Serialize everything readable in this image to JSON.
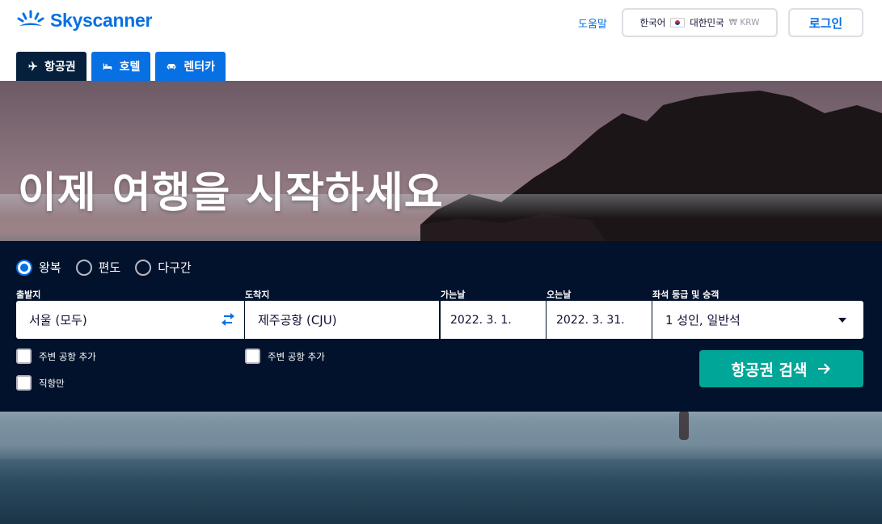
{
  "header": {
    "brand": "Skyscanner",
    "help_label": "도움말",
    "locale": {
      "language": "한국어",
      "country": "대한민국",
      "currency": "₩ KRW"
    },
    "login_label": "로그인"
  },
  "tabs": [
    {
      "label": "항공권",
      "icon": "airplane-icon",
      "active": true
    },
    {
      "label": "호텔",
      "icon": "bed-icon",
      "active": false
    },
    {
      "label": "렌터카",
      "icon": "car-icon",
      "active": false
    }
  ],
  "hero": {
    "title": "이제 여행을 시작하세요"
  },
  "search": {
    "trip_types": [
      {
        "label": "왕복",
        "checked": true
      },
      {
        "label": "편도",
        "checked": false
      },
      {
        "label": "다구간",
        "checked": false
      }
    ],
    "origin": {
      "label": "출발지",
      "value": "서울 (모두)"
    },
    "destination": {
      "label": "도착지",
      "value": "제주공항 (CJU)"
    },
    "depart": {
      "label": "가는날",
      "value": "2022. 3. 1."
    },
    "return": {
      "label": "오는날",
      "value": "2022. 3. 31."
    },
    "cabin": {
      "label": "좌석 등급 및 승객",
      "value": "1 성인, 일반석"
    },
    "nearby_origin_label": "주변 공항 추가",
    "nearby_dest_label": "주변 공항 추가",
    "direct_only_label": "직항만",
    "search_button_label": "항공권 검색"
  },
  "colors": {
    "brand_blue": "#0770e3",
    "panel_navy": "#02122c",
    "search_teal": "#00a698"
  }
}
